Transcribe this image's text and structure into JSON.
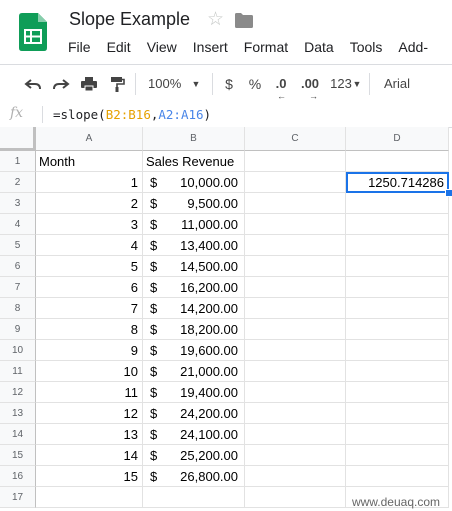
{
  "app": {
    "doc_title": "Slope Example",
    "menu": [
      "File",
      "Edit",
      "View",
      "Insert",
      "Format",
      "Data",
      "Tools",
      "Add-ons"
    ]
  },
  "toolbar": {
    "zoom": "100%",
    "currency": "$",
    "percent": "%",
    "dec_decrease": ".0",
    "dec_increase": ".00",
    "more_formats": "123",
    "font": "Arial"
  },
  "formula_bar": {
    "fx": "fx",
    "prefix": "=slope(",
    "ref1": "B2:B16",
    "comma": ",",
    "ref2": "A2:A16",
    "suffix": ")"
  },
  "sheet": {
    "columns": [
      "A",
      "B",
      "C",
      "D"
    ],
    "rows": [
      "1",
      "2",
      "3",
      "4",
      "5",
      "6",
      "7",
      "8",
      "9",
      "10",
      "11",
      "12",
      "13",
      "14",
      "15",
      "16",
      "17"
    ],
    "header": {
      "month": "Month",
      "sales": "Sales Revenue"
    },
    "currency_symbol": "$",
    "data": [
      {
        "month": "1",
        "sales": "10,000.00"
      },
      {
        "month": "2",
        "sales": "9,500.00"
      },
      {
        "month": "3",
        "sales": "11,000.00"
      },
      {
        "month": "4",
        "sales": "13,400.00"
      },
      {
        "month": "5",
        "sales": "14,500.00"
      },
      {
        "month": "6",
        "sales": "16,200.00"
      },
      {
        "month": "7",
        "sales": "14,200.00"
      },
      {
        "month": "8",
        "sales": "18,200.00"
      },
      {
        "month": "9",
        "sales": "19,600.00"
      },
      {
        "month": "10",
        "sales": "21,000.00"
      },
      {
        "month": "11",
        "sales": "19,400.00"
      },
      {
        "month": "12",
        "sales": "24,200.00"
      },
      {
        "month": "13",
        "sales": "24,100.00"
      },
      {
        "month": "14",
        "sales": "25,200.00"
      },
      {
        "month": "15",
        "sales": "26,800.00"
      }
    ],
    "d2_value": "1250.714286"
  },
  "watermark": "www.deuaq.com"
}
